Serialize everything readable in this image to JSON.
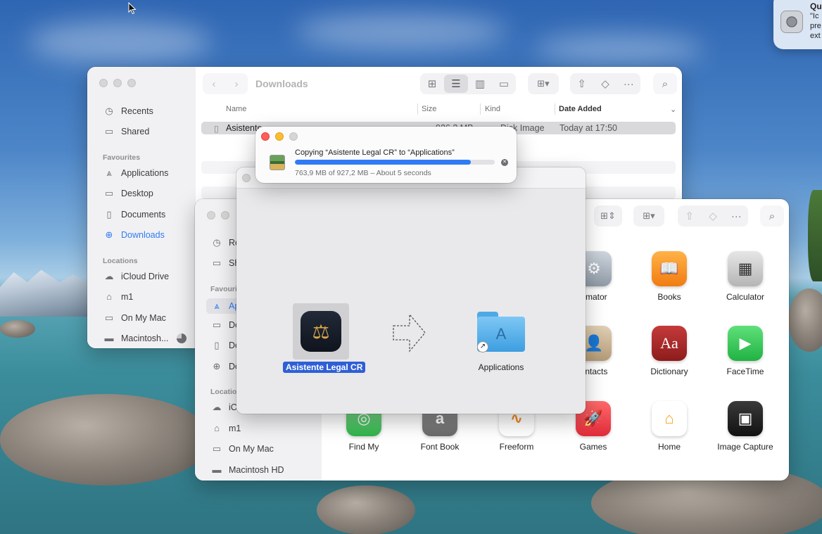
{
  "notification": {
    "title": "Qu",
    "lines": [
      "\"Ic",
      "pre",
      "ext"
    ]
  },
  "downloads_window": {
    "title": "Downloads",
    "sidebar": {
      "recents": "Recents",
      "shared": "Shared",
      "favourites_header": "Favourites",
      "applications": "Applications",
      "desktop": "Desktop",
      "documents": "Documents",
      "downloads": "Downloads",
      "locations_header": "Locations",
      "icloud": "iCloud Drive",
      "m1": "m1",
      "on_my_mac": "On My Mac",
      "macintosh": "Macintosh..."
    },
    "columns": {
      "name": "Name",
      "size": "Size",
      "kind": "Kind",
      "date_added": "Date Added"
    },
    "rows": [
      {
        "name": "Asistente",
        "size": "926,2 MB",
        "kind": "Disk Image",
        "date": "Today at 17:50"
      }
    ]
  },
  "apps_window": {
    "sidebar": {
      "recents": "Re",
      "shared": "Sh",
      "favourites_header": "Favouri",
      "applications": "Ap",
      "desktop": "De",
      "documents": "Do",
      "downloads": "Do",
      "locations_header": "Locatio",
      "icloud": "iCl",
      "m1": "m1",
      "on_my_mac": "On My Mac",
      "macintosh": "Macintosh HD"
    },
    "apps_row1": [
      "omator",
      "Books",
      "Calculator"
    ],
    "apps_row2": [
      "ontacts",
      "Dictionary",
      "FaceTime"
    ],
    "apps_row3": [
      "Find My",
      "Font Book",
      "Freeform",
      "Games",
      "Home",
      "Image Capture"
    ]
  },
  "dmg_window": {
    "app_label": "Asistente Legal CR",
    "folder_label": "Applications"
  },
  "copy_dialog": {
    "title": "Copying “Asistente Legal CR” to “Applications”",
    "status": "763,9 MB of 927,2 MB – About 5 seconds",
    "progress": 0.88
  },
  "colors": {
    "accent": "#2f7bf5",
    "close": "#ff5f57",
    "minimize": "#febc2e"
  }
}
